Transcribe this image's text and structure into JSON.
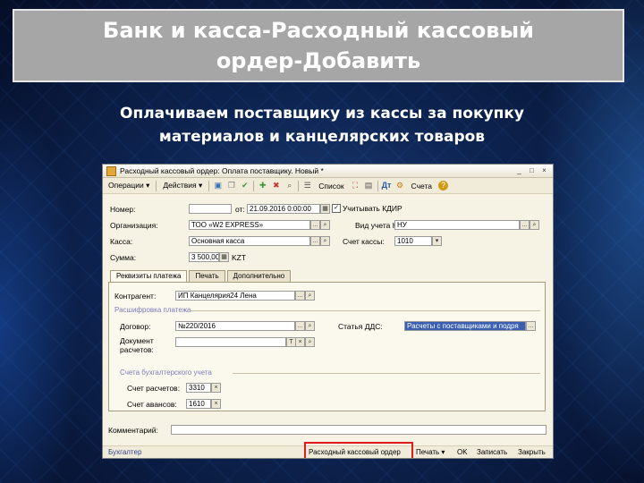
{
  "slide": {
    "title": "Банк и касса-Расходный кассовый ордер-Добавить",
    "subtitle": "Оплачиваем поставщику из кассы за покупку материалов и канцелярских товаров"
  },
  "window": {
    "title": "Расходный кассовый ордер: Оплата поставщику. Новый *",
    "controls": {
      "minimize": "_",
      "maximize": "□",
      "close": "×"
    }
  },
  "toolbar": {
    "operations": "Операции ▾",
    "actions": "Действия ▾",
    "list": "Список",
    "accounts": "Счета"
  },
  "form": {
    "number_label": "Номер:",
    "number_value": "",
    "from_label": "от:",
    "date_value": "21.09.2016 0:00:00",
    "account_kudir_label": "Учитывать КДИР",
    "org_label": "Организация:",
    "org_value": "ТОО «W2 EXPRESS»",
    "kind_label": "Вид учета НУ:",
    "kind_value": "НУ",
    "cash_label": "Касса:",
    "cash_value": "Основная касса",
    "cash_account_label": "Счет кассы:",
    "cash_account_value": "1010",
    "amount_label": "Сумма:",
    "amount_value": "3 500,00",
    "currency": "KZT"
  },
  "tabs": [
    {
      "label": "Реквизиты платежа"
    },
    {
      "label": "Печать"
    },
    {
      "label": "Дополнительно"
    }
  ],
  "details": {
    "counterparty_label": "Контрагент:",
    "counterparty_value": "ИП Канцелярия24 Лена",
    "section_payment": "Расшифровка платежа",
    "contract_label": "Договор:",
    "contract_value": "№220/2016",
    "dds_label": "Статья ДДС:",
    "dds_value": "Расчеты с поставщиками и подря",
    "doc_label_1": "Документ",
    "doc_label_2": "расчетов:",
    "section_accounts": "Счета бухгалтерского учета",
    "settlement_label": "Счет расчетов:",
    "settlement_value": "3310",
    "advance_label": "Счет авансов:",
    "advance_value": "1610"
  },
  "comment_label": "Комментарий:",
  "statusbar": {
    "user": "Бухгалтер",
    "print_form": "Расходный кассовый ордер",
    "print": "Печать ▾",
    "ok": "OK",
    "save": "Записать",
    "close": "Закрыть"
  }
}
